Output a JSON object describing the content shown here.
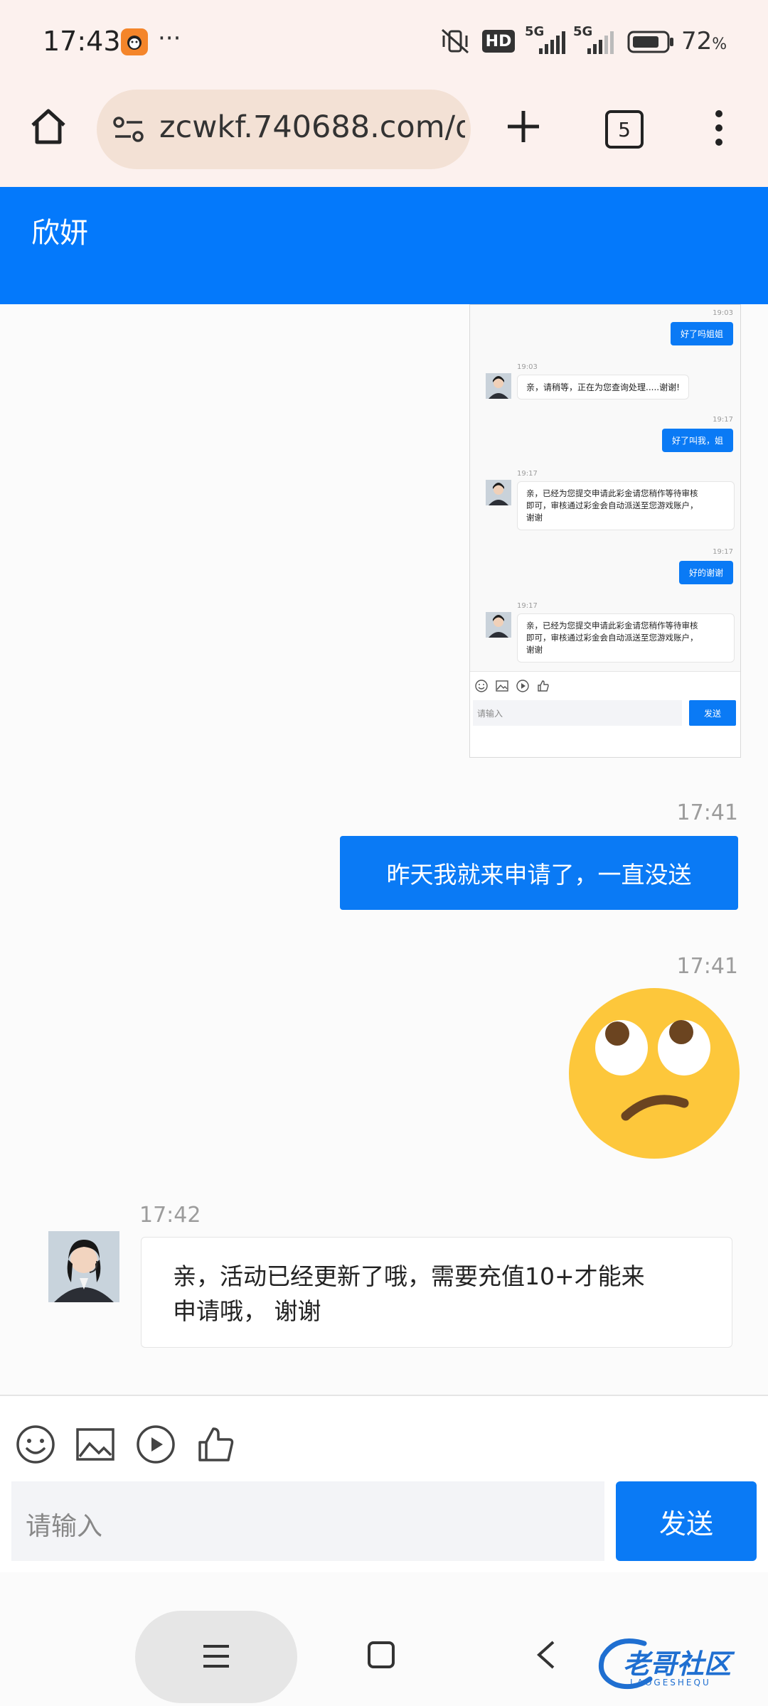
{
  "status_bar": {
    "time": "17:43",
    "more": "···",
    "hd": "HD",
    "net1": "5G",
    "net2": "5G",
    "battery": "72",
    "battery_unit": "%"
  },
  "browser": {
    "url": "zcwkf.740688.com/d",
    "tab_count": "5"
  },
  "chat": {
    "title": "欣妍",
    "screenshot": {
      "messages": [
        {
          "time": "19:03",
          "from": "me",
          "text": "好了吗姐姐"
        },
        {
          "time": "19:03",
          "from": "agent",
          "text": "亲，请稍等，正在为您查询处理.....谢谢!"
        },
        {
          "time": "19:17",
          "from": "me",
          "text": "好了叫我，姐"
        },
        {
          "time": "19:17",
          "from": "agent",
          "lines": [
            "亲，已经为您提交申请此彩金请您稍作等待审核",
            "即可，审核通过彩金会自动派送至您游戏账户，",
            "谢谢"
          ]
        },
        {
          "time": "19:17",
          "from": "me",
          "text": "好的谢谢"
        },
        {
          "time": "19:17",
          "from": "agent",
          "lines": [
            "亲，已经为您提交申请此彩金请您稍作等待审核",
            "即可，审核通过彩金会自动派送至您游戏账户，",
            "谢谢"
          ]
        }
      ],
      "input_placeholder": "请输入",
      "send_label": "发送"
    },
    "messages": [
      {
        "time": "17:41",
        "text": "昨天我就来申请了，一直没送"
      },
      {
        "time": "17:41",
        "emoji": "face-with-rolling-eyes"
      },
      {
        "time": "17:42",
        "lines": [
          "亲，活动已经更新了哦，需要充值10+才能来",
          "申请哦， 谢谢"
        ]
      }
    ],
    "input_placeholder": "请输入",
    "send_label": "发送"
  },
  "watermark": {
    "title": "老哥社区",
    "subtitle": "LAOGESHEQU"
  }
}
